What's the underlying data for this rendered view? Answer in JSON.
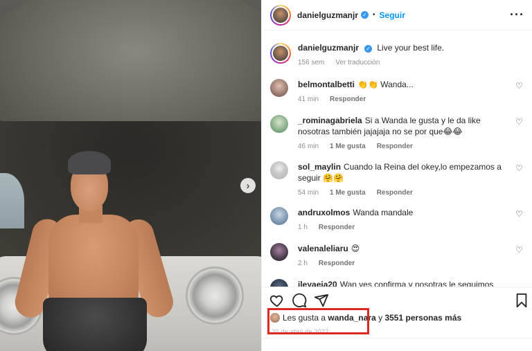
{
  "post": {
    "author": "danielguzmanjr",
    "follow_label": "Seguir",
    "dot": "•",
    "more_label": "···",
    "caption": "Live your best life.",
    "caption_age": "156 sem",
    "see_translation": "Ver traducción"
  },
  "comments": [
    {
      "user": "belmontalbetti",
      "text": "👏👏 Wanda...",
      "age": "41 min",
      "likes": "",
      "reply": "Responder",
      "avatar_color": "#8c6d63"
    },
    {
      "user": "_rominagabriela",
      "text": "Si a Wanda le gusta y le da like nosotras también jajajaja no se por que😂😂",
      "age": "46 min",
      "likes": "1 Me gusta",
      "reply": "Responder",
      "avatar_color": "#7aa37d"
    },
    {
      "user": "sol_maylin",
      "text": "Cuando la Reina del okey,lo empezamos a seguir 🤗🤗",
      "age": "54 min",
      "likes": "1 Me gusta",
      "reply": "Responder",
      "avatar_color": "#c9c9c9"
    },
    {
      "user": "andruxolmos",
      "text": "Wanda mandale",
      "age": "1 h",
      "likes": "",
      "reply": "Responder",
      "avatar_color": "#6f8aa8"
    },
    {
      "user": "valenaleliaru",
      "text": "😍",
      "age": "2 h",
      "likes": "",
      "reply": "Responder",
      "avatar_color": "#3b3340"
    },
    {
      "user": "ileyaeia20",
      "text": "Wan ves confirma y nosotras le seguimos ✨ usted",
      "age": "",
      "likes": "",
      "reply": "",
      "avatar_color": "#223344"
    }
  ],
  "likes": {
    "prefix": "Les gusta a",
    "user": "wanda_nara",
    "connector": "y",
    "rest": "3551 personas más"
  },
  "date": "20 de abril de 2022",
  "icons": {
    "heart": "heart-icon",
    "comment": "comment-icon",
    "share": "share-icon",
    "save": "bookmark-icon"
  },
  "colors": {
    "link_blue": "#0095f6",
    "verified_blue": "#3897f0",
    "highlight_red": "#e02525"
  }
}
